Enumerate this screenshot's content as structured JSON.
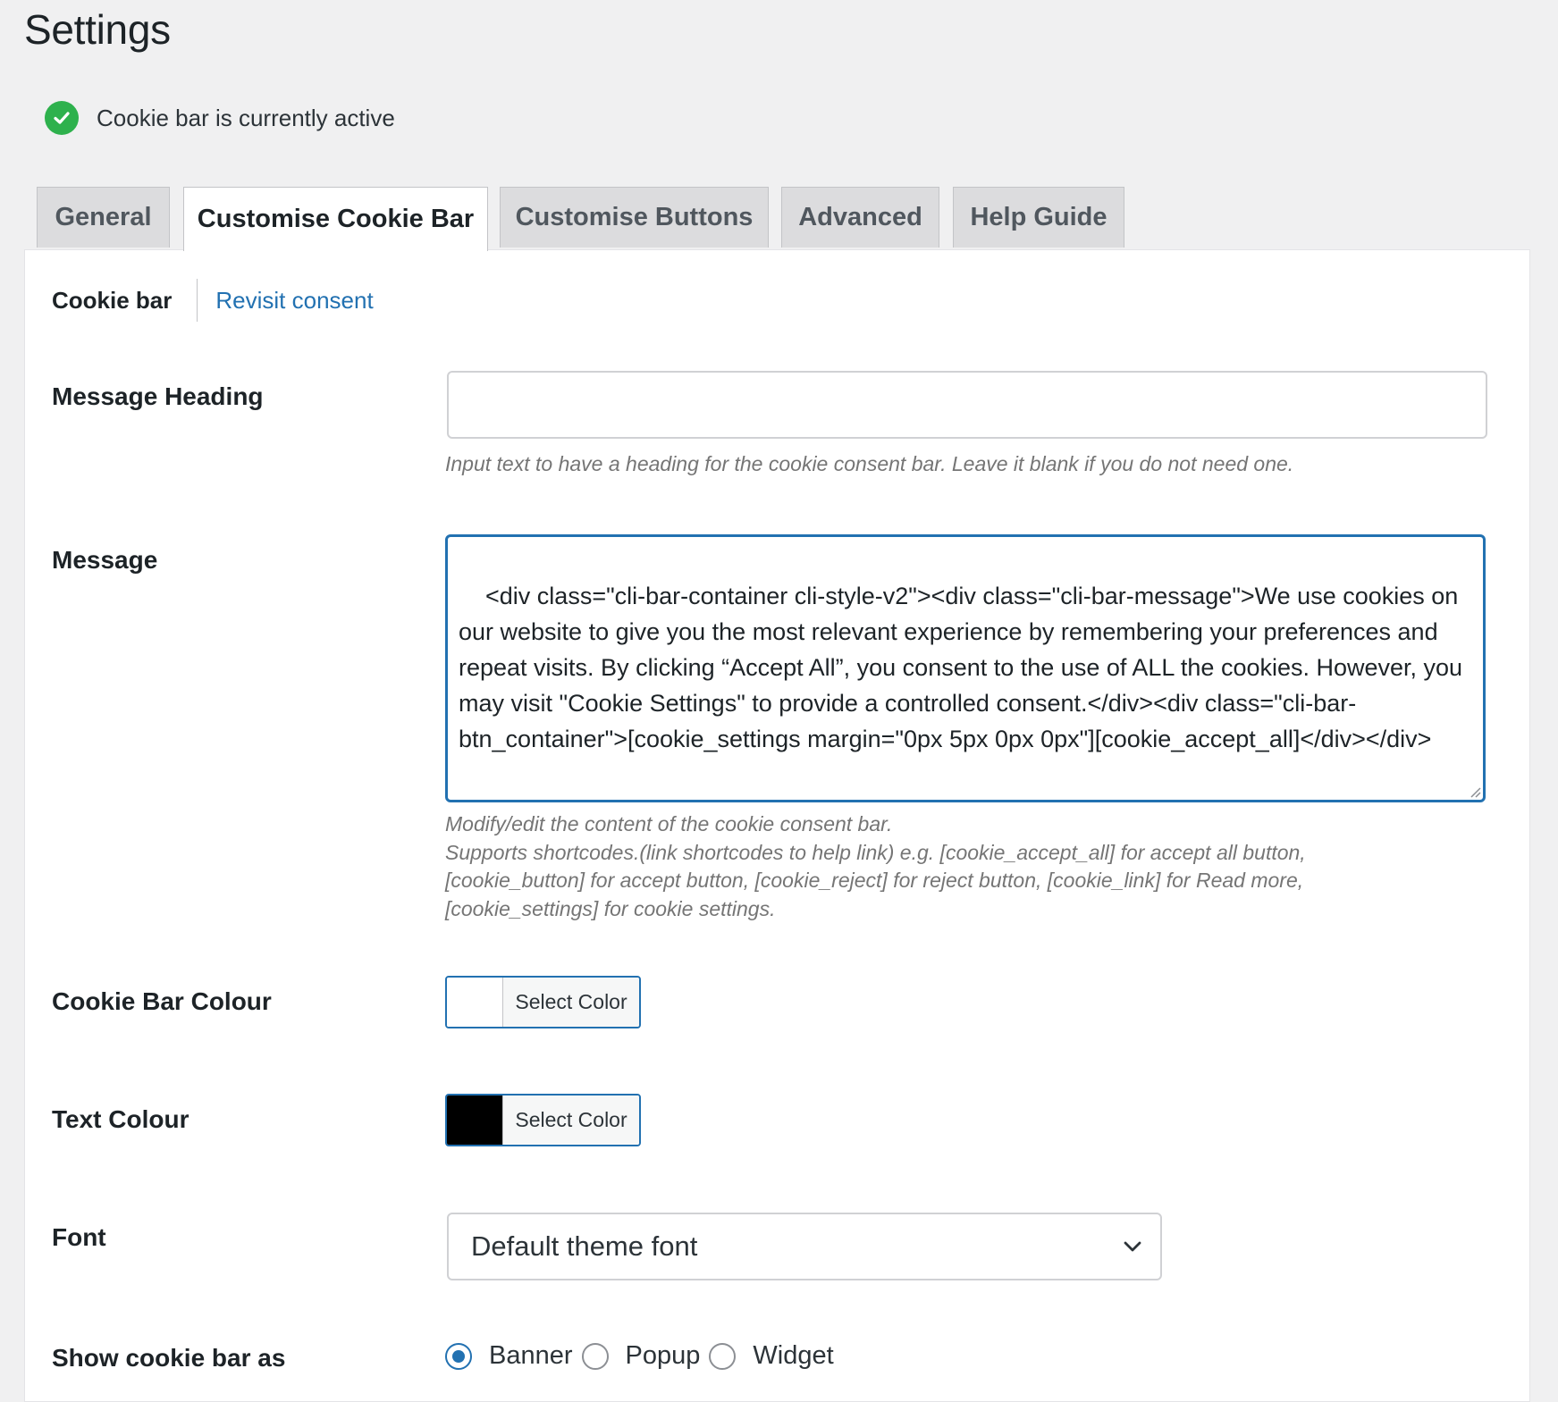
{
  "page": {
    "title": "Settings"
  },
  "status": {
    "text": "Cookie bar is currently active",
    "icon": "check-circle-icon",
    "color": "#2eb14d"
  },
  "tabs": [
    {
      "label": "General",
      "active": false
    },
    {
      "label": "Customise Cookie Bar",
      "active": true
    },
    {
      "label": "Customise Buttons",
      "active": false
    },
    {
      "label": "Advanced",
      "active": false
    },
    {
      "label": "Help Guide",
      "active": false
    }
  ],
  "subnav": {
    "current": "Cookie bar",
    "link": "Revisit consent"
  },
  "fields": {
    "message_heading": {
      "label": "Message Heading",
      "value": "",
      "help": "Input text to have a heading for the cookie consent bar. Leave it blank if you do not need one."
    },
    "message": {
      "label": "Message",
      "value": "<div class=\"cli-bar-container cli-style-v2\"><div class=\"cli-bar-message\">We use cookies on our website to give you the most relevant experience by remembering your preferences and repeat visits. By clicking “Accept All”, you consent to the use of ALL the cookies. However, you may visit \"Cookie Settings\" to provide a controlled consent.</div><div class=\"cli-bar-btn_container\">[cookie_settings margin=\"0px 5px 0px 0px\"][cookie_accept_all]</div></div>",
      "help_line1": "Modify/edit the content of the cookie consent bar.",
      "help_line2": "Supports shortcodes.(link shortcodes to help link) e.g. [cookie_accept_all] for accept all button,",
      "help_line3": "[cookie_button] for accept button, [cookie_reject] for reject button, [cookie_link] for Read more,",
      "help_line4": "[cookie_settings] for cookie settings."
    },
    "bar_colour": {
      "label": "Cookie Bar Colour",
      "button": "Select Color",
      "swatch": "#ffffff"
    },
    "text_colour": {
      "label": "Text Colour",
      "button": "Select Color",
      "swatch": "#000000"
    },
    "font": {
      "label": "Font",
      "selected": "Default theme font",
      "icon": "chevron-down-icon"
    },
    "show_as": {
      "label": "Show cookie bar as",
      "options": [
        {
          "label": "Banner",
          "checked": true
        },
        {
          "label": "Popup",
          "checked": false
        },
        {
          "label": "Widget",
          "checked": false
        }
      ]
    }
  },
  "colors": {
    "accent": "#2271b1",
    "background": "#f0f0f1"
  }
}
